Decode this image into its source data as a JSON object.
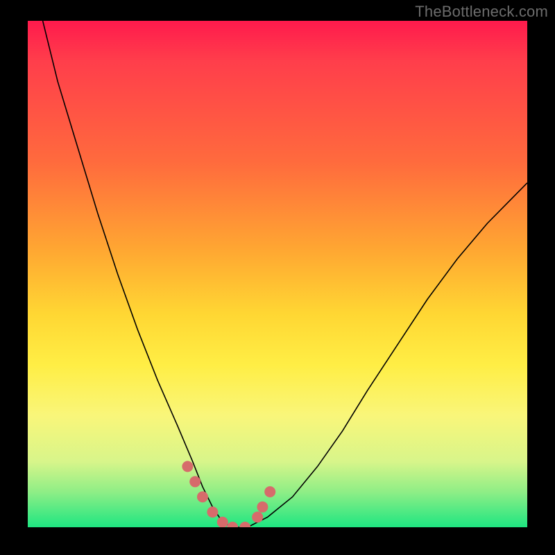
{
  "watermark": "TheBottleneck.com",
  "chart_data": {
    "type": "line",
    "title": "",
    "xlabel": "",
    "ylabel": "",
    "xlim": [
      0,
      100
    ],
    "ylim": [
      0,
      100
    ],
    "legend": false,
    "grid": false,
    "background": "vertical-gradient red→orange→yellow→green (top→bottom)",
    "series": [
      {
        "name": "bottleneck-curve",
        "x": [
          3,
          6,
          10,
          14,
          18,
          22,
          26,
          30,
          33,
          35,
          37,
          39,
          41,
          44,
          48,
          53,
          58,
          63,
          68,
          74,
          80,
          86,
          92,
          98,
          100
        ],
        "y": [
          100,
          88,
          75,
          62,
          50,
          39,
          29,
          20,
          13,
          8,
          4,
          1,
          0,
          0,
          2,
          6,
          12,
          19,
          27,
          36,
          45,
          53,
          60,
          66,
          68
        ]
      }
    ],
    "markers": {
      "name": "highlight-dots",
      "color": "#d66b6b",
      "x": [
        32,
        33.5,
        35,
        37,
        39,
        41,
        43.5,
        46,
        47,
        48.5
      ],
      "y": [
        12,
        9,
        6,
        3,
        1,
        0,
        0,
        2,
        4,
        7
      ]
    },
    "notes": "Axes have no ticks or labels; black frame margins on all four sides. Curve is black, ~1.5px stroke. A short run of salmon-colored dots sits at the valley of the curve."
  }
}
